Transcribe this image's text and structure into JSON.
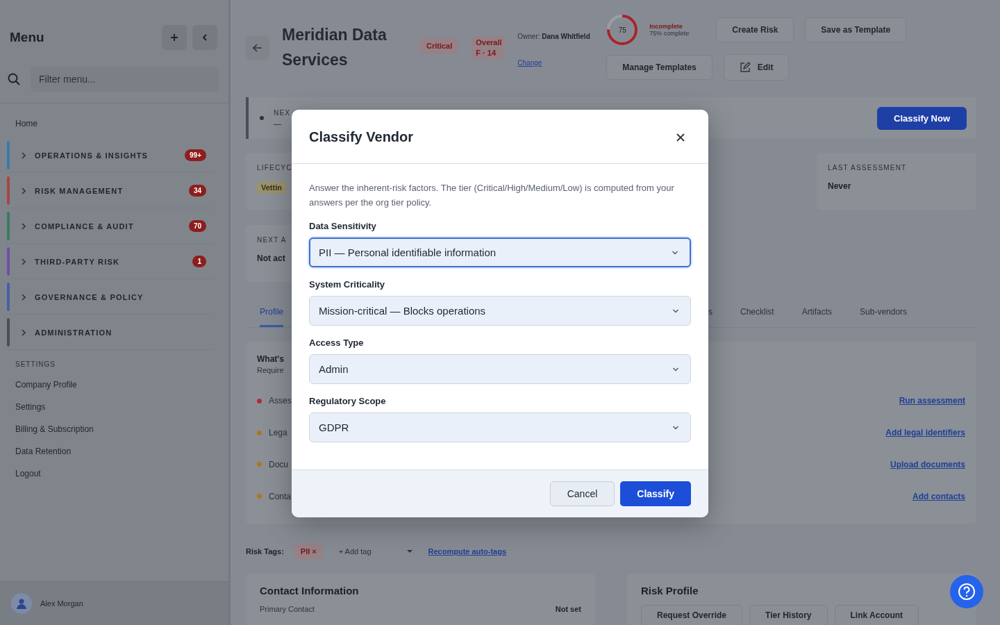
{
  "sidebar": {
    "title": "Menu",
    "search": {
      "placeholder": "Filter menu..."
    },
    "home": "Home",
    "groups": [
      {
        "label": "OPERATIONS & INSIGHTS",
        "badge": "99+",
        "color": "#3a7aa8",
        "expanded": false
      },
      {
        "label": "RISK MANAGEMENT",
        "badge": "34",
        "color": "#a84545",
        "expanded": false
      },
      {
        "label": "COMPLIANCE & AUDIT",
        "badge": "70",
        "color": "#3c7a5f",
        "expanded": false
      },
      {
        "label": "THIRD-PARTY RISK",
        "badge": "1",
        "color": "#6e4fa6",
        "expanded": false
      },
      {
        "label": "GOVERNANCE & POLICY",
        "color": "#4560a8",
        "expanded": false
      },
      {
        "label": "ADMINISTRATION",
        "color": "#4a4f57",
        "expanded": false
      }
    ],
    "settings_heading": "SETTINGS",
    "settings_items": [
      "Company Profile",
      "Settings",
      "Billing & Subscription",
      "Data Retention",
      "Logout"
    ],
    "user": {
      "name": "Alex Morgan"
    }
  },
  "header": {
    "vendor_name": "Meridian Data Services",
    "tier_badge": "Critical",
    "overall_badge": "Overall F · 14",
    "owner_label": "Owner:",
    "owner_name": "Dana Whitfield",
    "owner_link": "Change",
    "progress": {
      "value": "75",
      "level": 0.75,
      "status": "Incomplete",
      "caption": "75% complete"
    },
    "buttons": [
      "Create Risk",
      "Save as Template",
      "Manage Templates",
      "Edit"
    ]
  },
  "banner": {
    "label": "NEX",
    "value": "—",
    "button": "Classify Now"
  },
  "cards": [
    {
      "label": "LIFECYC",
      "value": "Vettin",
      "kind": "badge"
    },
    {
      "label": "LAST ASSESSMENT",
      "value": "Never",
      "kind": "text"
    }
  ],
  "next_card": {
    "label": "NEXT A",
    "value": "Not act"
  },
  "tabs": [
    {
      "label": "Profile",
      "selected": true
    },
    {
      "label": "s",
      "selected": false
    },
    {
      "label": "Checklist",
      "selected": false
    },
    {
      "label": "Artifacts",
      "selected": false
    },
    {
      "label": "Sub-vendors",
      "selected": false
    }
  ],
  "required": {
    "title": "What's",
    "subtitle": "Require",
    "items": [
      {
        "label": "Asses",
        "color": "#b02e33",
        "link": "Run assessment"
      },
      {
        "label": "Lega",
        "color": "#b07420",
        "link": "Add legal identifiers"
      },
      {
        "label": "Docu",
        "color": "#b07420",
        "link": "Upload documents"
      },
      {
        "label": "Conta",
        "color": "#b07420",
        "link": "Add contacts"
      }
    ]
  },
  "risk_tags": {
    "label": "Risk Tags:",
    "tags": [
      "PII ×"
    ],
    "add_placeholder": "+ Add tag",
    "recompute": "Recompute auto-tags"
  },
  "contact": {
    "title": "Contact Information",
    "row_label": "Primary Contact",
    "row_value": "Not set"
  },
  "risk_profile": {
    "title": "Risk Profile",
    "buttons": [
      "Request Override",
      "Tier History",
      "Link Account"
    ]
  },
  "modal": {
    "title": "Classify Vendor",
    "description": "Answer the inherent-risk factors. The tier (Critical/High/Medium/Low) is computed from your answers per the org tier policy.",
    "fields": [
      {
        "label": "Data Sensitivity",
        "value": "PII — Personal identifiable information",
        "focused": true
      },
      {
        "label": "System Criticality",
        "value": "Mission-critical — Blocks operations",
        "focused": false
      },
      {
        "label": "Access Type",
        "value": "Admin",
        "focused": false
      },
      {
        "label": "Regulatory Scope",
        "value": "GDPR",
        "focused": false
      }
    ],
    "cancel": "Cancel",
    "submit": "Classify"
  }
}
